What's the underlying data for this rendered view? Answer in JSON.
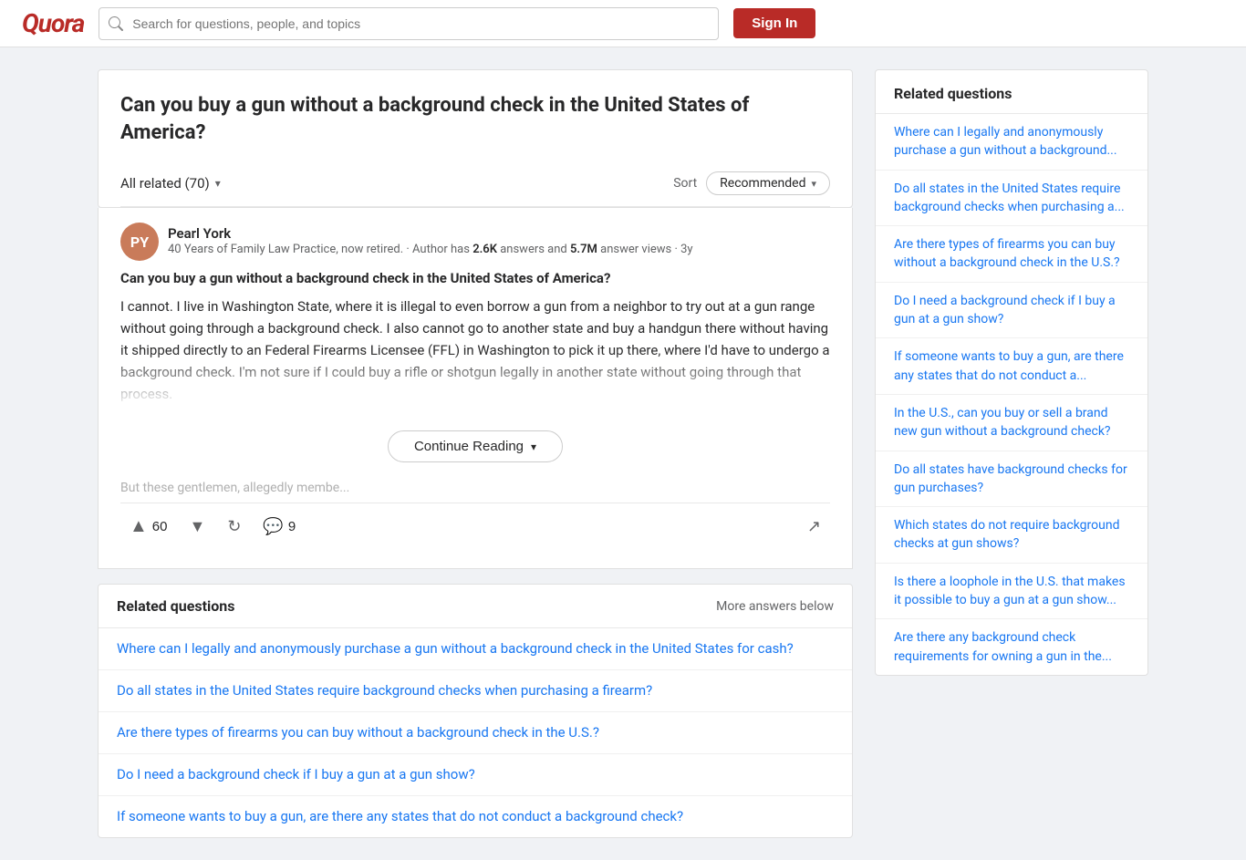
{
  "header": {
    "logo": "Quora",
    "search_placeholder": "Search for questions, people, and topics",
    "signin_label": "Sign In"
  },
  "question": {
    "title": "Can you buy a gun without a background check in the United States of America?",
    "filter_label": "All related (70)",
    "sort_label": "Sort",
    "sort_value": "Recommended"
  },
  "answer": {
    "author_name": "Pearl York",
    "author_initials": "PY",
    "author_bio": "40 Years of Family Law Practice, now retired. · Author has 2.6K answers and 5.7M answer views · 3y",
    "author_answers": "2.6K",
    "author_views": "5.7M",
    "answer_question": "Can you buy a gun without a background check in the United States of America?",
    "answer_body": "I cannot. I live in Washington State, where it is illegal to even borrow a gun from a neighbor to try out at a gun range without going through a background check. I also cannot go to another state and buy a handgun there without having it shipped directly to an Federal Firearms Licensee (FFL) in Washington to pick it up there, where I'd have to undergo a background check. I'm not sure if I could buy a rifle or shotgun legally in another state without going through that process.",
    "answer_tail": "But these gentlemen, allegedly membe...",
    "upvote_count": "60",
    "comment_count": "9",
    "continue_reading": "Continue Reading"
  },
  "related_inline": {
    "title": "Related questions",
    "more_answers": "More answers below",
    "questions": [
      "Where can I legally and anonymously purchase a gun without a background check in the United States for cash?",
      "Do all states in the United States require background checks when purchasing a firearm?",
      "Are there types of firearms you can buy without a background check in the U.S.?",
      "Do I need a background check if I buy a gun at a gun show?",
      "If someone wants to buy a gun, are there any states that do not conduct a background check?"
    ]
  },
  "sidebar": {
    "title": "Related questions",
    "questions": [
      "Where can I legally and anonymously purchase a gun without a background...",
      "Do all states in the United States require background checks when purchasing a...",
      "Are there types of firearms you can buy without a background check in the U.S.?",
      "Do I need a background check if I buy a gun at a gun show?",
      "If someone wants to buy a gun, are there any states that do not conduct a...",
      "In the U.S., can you buy or sell a brand new gun without a background check?",
      "Do all states have background checks for gun purchases?",
      "Which states do not require background checks at gun shows?",
      "Is there a loophole in the U.S. that makes it possible to buy a gun at a gun show...",
      "Are there any background check requirements for owning a gun in the..."
    ]
  }
}
